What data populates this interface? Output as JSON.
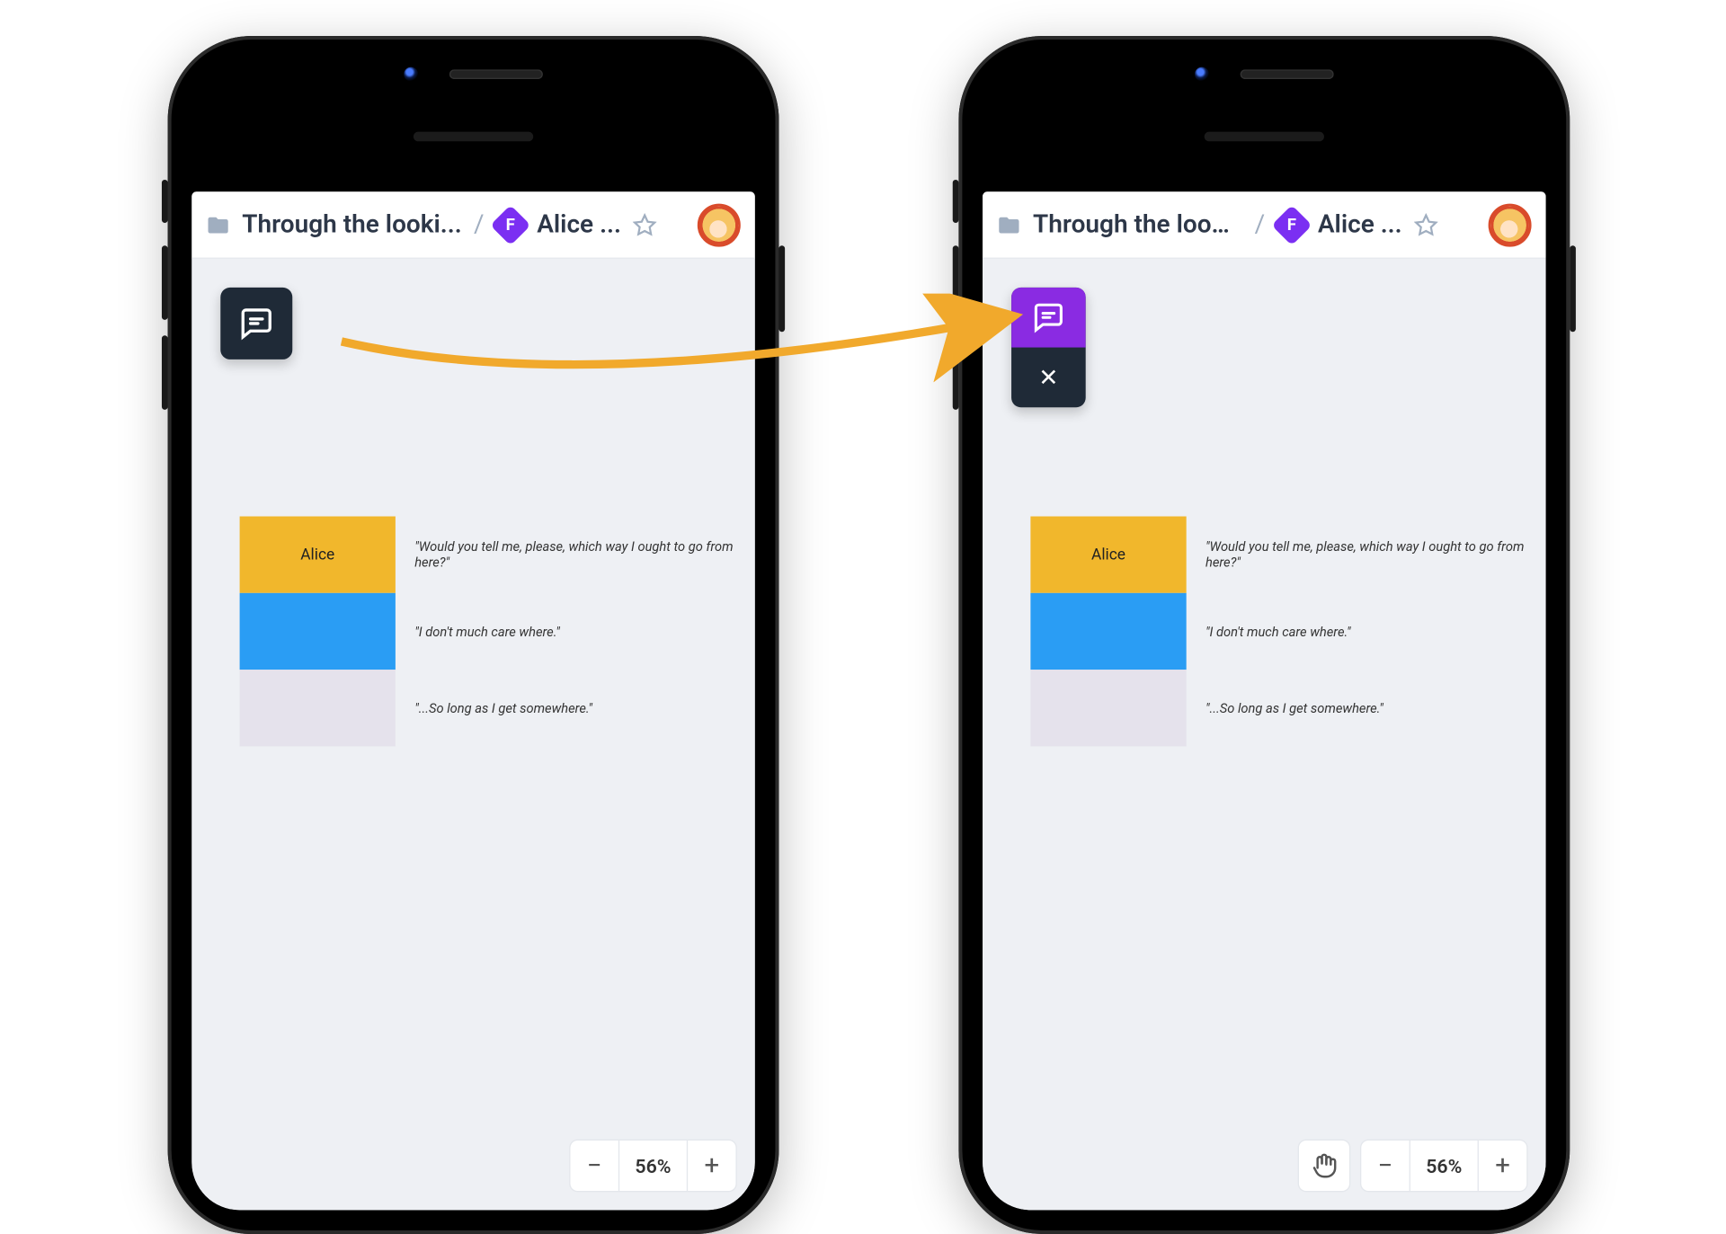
{
  "header": {
    "folder_label": "Through the looki...",
    "file_label": "Alice ...",
    "separator": "/",
    "figma_letter": "F"
  },
  "content": {
    "character": "Alice",
    "quotes": [
      "\"Would you tell me, please, which way I ought to go from here?\"",
      "\"I don't much care where.\"",
      "\"...So long as I get somewhere.\""
    ]
  },
  "zoom": {
    "level": "56%",
    "minus": "−",
    "plus": "+"
  },
  "panel": {
    "close": "✕"
  },
  "colors": {
    "yellow": "#f1b72c",
    "blue": "#2a9df4",
    "grey": "#e5e2ec",
    "purple": "#8a2be2",
    "dark": "#1f2a37"
  }
}
